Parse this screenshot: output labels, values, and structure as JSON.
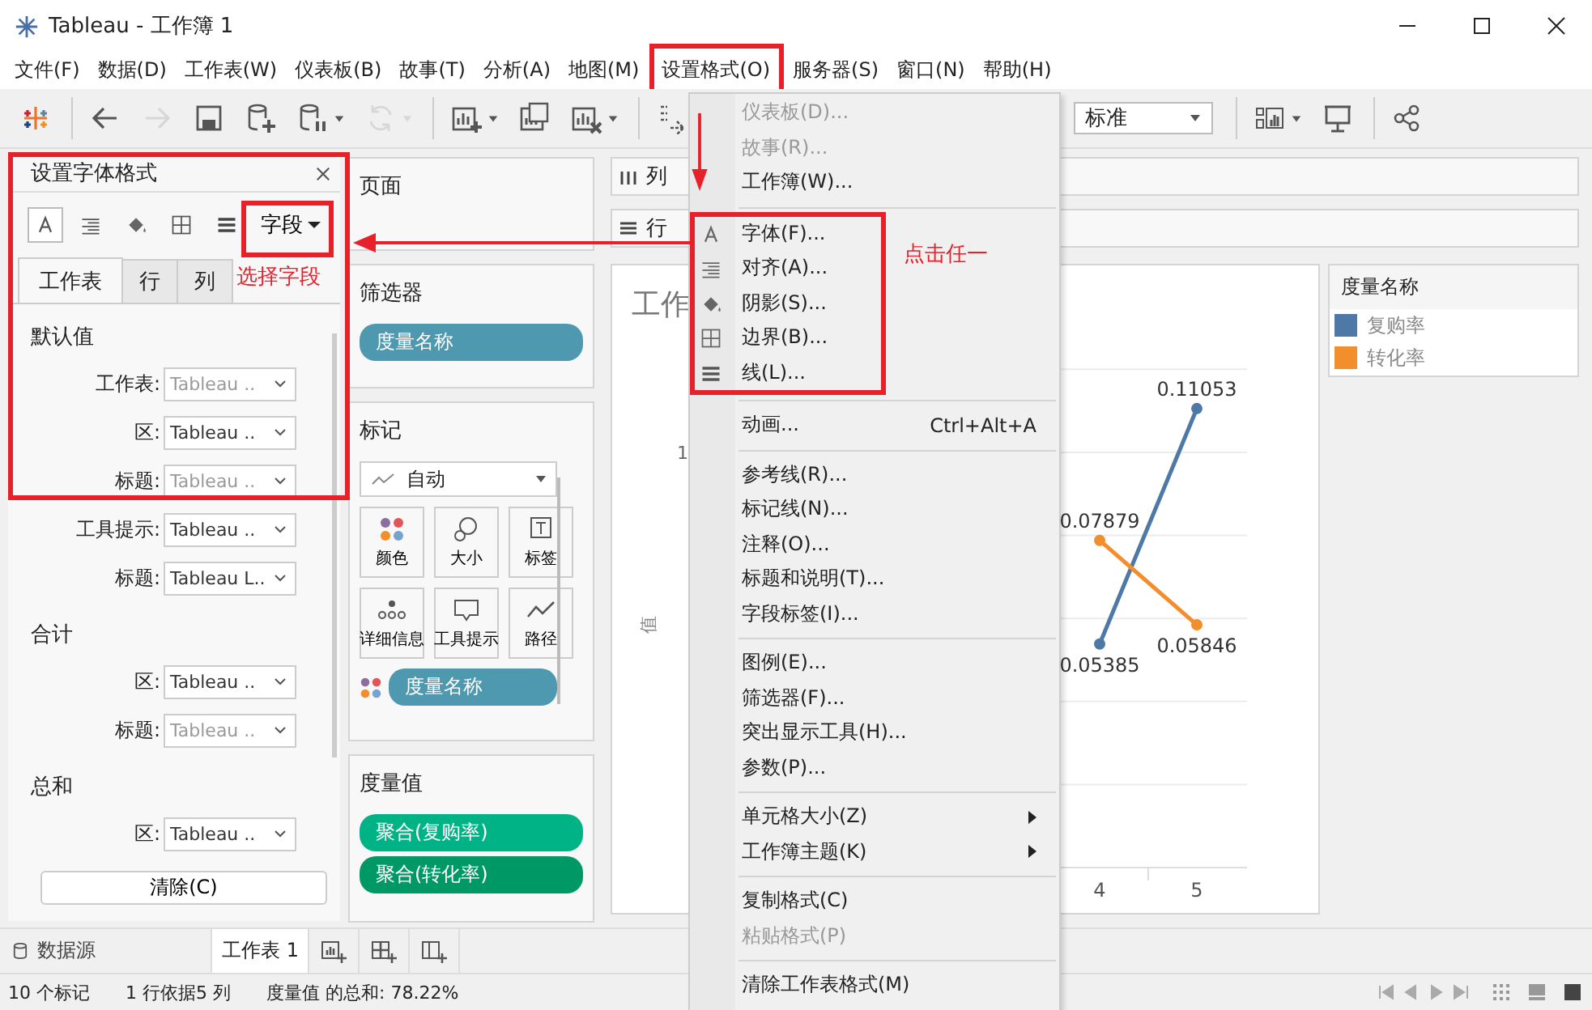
{
  "window": {
    "title": "Tableau - 工作簿 1"
  },
  "menu_bar": [
    {
      "label": "文件(F)",
      "selected": false
    },
    {
      "label": "数据(D)",
      "selected": false
    },
    {
      "label": "工作表(W)",
      "selected": false
    },
    {
      "label": "仪表板(B)",
      "selected": false
    },
    {
      "label": "故事(T)",
      "selected": false
    },
    {
      "label": "分析(A)",
      "selected": false
    },
    {
      "label": "地图(M)",
      "selected": false
    },
    {
      "label": "设置格式(O)",
      "selected": true
    },
    {
      "label": "服务器(S)",
      "selected": false
    },
    {
      "label": "窗口(N)",
      "selected": false
    },
    {
      "label": "帮助(H)",
      "selected": false
    }
  ],
  "toolbar": {
    "buttons": [
      {
        "kind": "logo",
        "disabled": false
      },
      {
        "kind": "back",
        "disabled": false
      },
      {
        "kind": "forward",
        "disabled": true
      },
      {
        "kind": "save",
        "disabled": false
      },
      {
        "kind": "new-data-source",
        "disabled": false
      },
      {
        "kind": "pause",
        "disabled": false
      },
      {
        "kind": "refresh",
        "disabled": true
      },
      {
        "kind": "new-sheet",
        "disabled": false
      },
      {
        "kind": "duplicate",
        "disabled": false
      },
      {
        "kind": "clear",
        "disabled": false
      },
      {
        "kind": "swap",
        "disabled": false
      }
    ],
    "fit": "标准",
    "right_buttons": [
      {
        "kind": "show-me",
        "disabled": false
      },
      {
        "kind": "presentation",
        "disabled": false
      },
      {
        "kind": "share",
        "disabled": false
      }
    ]
  },
  "format_pane": {
    "title": "设置字体格式",
    "tools": [
      {
        "kind": "font",
        "selected": true
      },
      {
        "kind": "align",
        "selected": false
      },
      {
        "kind": "shading",
        "selected": false
      },
      {
        "kind": "borders",
        "selected": false
      },
      {
        "kind": "lines",
        "selected": false
      }
    ],
    "field_button": "字段",
    "tabs": [
      {
        "label": "工作表",
        "selected": true
      },
      {
        "label": "行",
        "selected": false
      },
      {
        "label": "列",
        "selected": false
      }
    ],
    "sections": [
      {
        "title": "默认值",
        "rows": [
          {
            "label": "工作表:",
            "value": "Tableau ..",
            "greyed": true
          },
          {
            "label": "区:",
            "value": "Tableau ..",
            "greyed": false
          },
          {
            "label": "标题:",
            "value": "Tableau ..",
            "greyed": true
          },
          {
            "label": "工具提示:",
            "value": "Tableau ..",
            "greyed": false
          },
          {
            "label": "标题:",
            "value": "Tableau L..",
            "greyed": false
          }
        ]
      },
      {
        "title": "合计",
        "rows": [
          {
            "label": "区:",
            "value": "Tableau ..",
            "greyed": false
          },
          {
            "label": "标题:",
            "value": "Tableau ..",
            "greyed": true
          }
        ]
      },
      {
        "title": "总和",
        "rows": [
          {
            "label": "区:",
            "value": "Tableau ..",
            "greyed": false
          }
        ]
      }
    ],
    "clear_button": "清除(C)"
  },
  "pages_card": {
    "title": "页面"
  },
  "filters_card": {
    "title": "筛选器",
    "pills": [
      {
        "label": "度量名称",
        "color": "#4e98b0"
      }
    ]
  },
  "marks_card": {
    "title": "标记",
    "mark_type": "自动",
    "buttons": [
      {
        "kind": "color",
        "label": "颜色"
      },
      {
        "kind": "size",
        "label": "大小"
      },
      {
        "kind": "label",
        "label": "标签"
      },
      {
        "kind": "detail",
        "label": "详细信息"
      },
      {
        "kind": "tooltip",
        "label": "工具提示"
      },
      {
        "kind": "path",
        "label": "路径"
      }
    ],
    "pills": [
      {
        "label": "度量名称",
        "color": "#4e98b0"
      }
    ]
  },
  "measure_values_card": {
    "title": "度量值",
    "pills": [
      {
        "label": "聚合(复购率)",
        "color": "#00b386"
      },
      {
        "label": "聚合(转化率)",
        "color": "#009966"
      }
    ]
  },
  "columns_shelf": {
    "label": "列"
  },
  "rows_shelf": {
    "label": "行"
  },
  "view": {
    "title": "工作",
    "axis_label": "值",
    "chart_data": {
      "type": "line",
      "categories": [
        "4",
        "5"
      ],
      "series": [
        {
          "name": "复购率",
          "color": "#4e79a7",
          "marker": "circle",
          "values": [
            0.05385,
            0.11053
          ]
        },
        {
          "name": "转化率",
          "color": "#f28e2b",
          "marker": "circle",
          "values": [
            0.07879,
            0.05846
          ]
        }
      ],
      "data_labels": true
    },
    "tick_fragment": "1"
  },
  "legend": {
    "title": "度量名称"
  },
  "format_menu": {
    "items": [
      {
        "kind": "item",
        "label": "仪表板(D)...",
        "disabled": true
      },
      {
        "kind": "item",
        "label": "故事(R)...",
        "disabled": true
      },
      {
        "kind": "item",
        "label": "工作簿(W)...",
        "disabled": false
      },
      {
        "kind": "separator"
      },
      {
        "kind": "font",
        "label": "字体(F)...",
        "disabled": false
      },
      {
        "kind": "align",
        "label": "对齐(A)...",
        "disabled": false
      },
      {
        "kind": "shading",
        "label": "阴影(S)...",
        "disabled": false
      },
      {
        "kind": "borders",
        "label": "边界(B)...",
        "disabled": false
      },
      {
        "kind": "lines",
        "label": "线(L)...",
        "disabled": false
      },
      {
        "kind": "separator"
      },
      {
        "kind": "item",
        "label": "动画...",
        "shortcut": "Ctrl+Alt+A",
        "disabled": false
      },
      {
        "kind": "separator"
      },
      {
        "kind": "item",
        "label": "参考线(R)...",
        "disabled": false
      },
      {
        "kind": "item",
        "label": "标记线(N)...",
        "disabled": false
      },
      {
        "kind": "item",
        "label": "注释(O)...",
        "disabled": false
      },
      {
        "kind": "item",
        "label": "标题和说明(T)...",
        "disabled": false
      },
      {
        "kind": "item",
        "label": "字段标签(I)...",
        "disabled": false
      },
      {
        "kind": "separator"
      },
      {
        "kind": "item",
        "label": "图例(E)...",
        "disabled": false
      },
      {
        "kind": "item",
        "label": "筛选器(F)...",
        "disabled": false
      },
      {
        "kind": "item",
        "label": "突出显示工具(H)...",
        "disabled": false
      },
      {
        "kind": "item",
        "label": "参数(P)...",
        "disabled": false
      },
      {
        "kind": "separator"
      },
      {
        "kind": "submenu",
        "label": "单元格大小(Z)",
        "disabled": false
      },
      {
        "kind": "submenu",
        "label": "工作簿主题(K)",
        "disabled": false
      },
      {
        "kind": "separator"
      },
      {
        "kind": "item",
        "label": "复制格式(C)",
        "disabled": false
      },
      {
        "kind": "item",
        "label": "粘贴格式(P)",
        "disabled": true
      },
      {
        "kind": "separator"
      },
      {
        "kind": "item",
        "label": "清除工作表格式(M)",
        "disabled": false
      }
    ]
  },
  "annotations": [
    {
      "kind": "field-hint",
      "text": "选择字段"
    },
    {
      "kind": "menu-hint",
      "text": "点击任一"
    }
  ],
  "sheet_tabs": {
    "data_source": "数据源",
    "tabs": [
      {
        "label": "工作表 1",
        "selected": true
      }
    ]
  },
  "status_bar": [
    "10 个标记",
    "1 行依据5 列",
    "度量值 的总和: 78.22%"
  ]
}
